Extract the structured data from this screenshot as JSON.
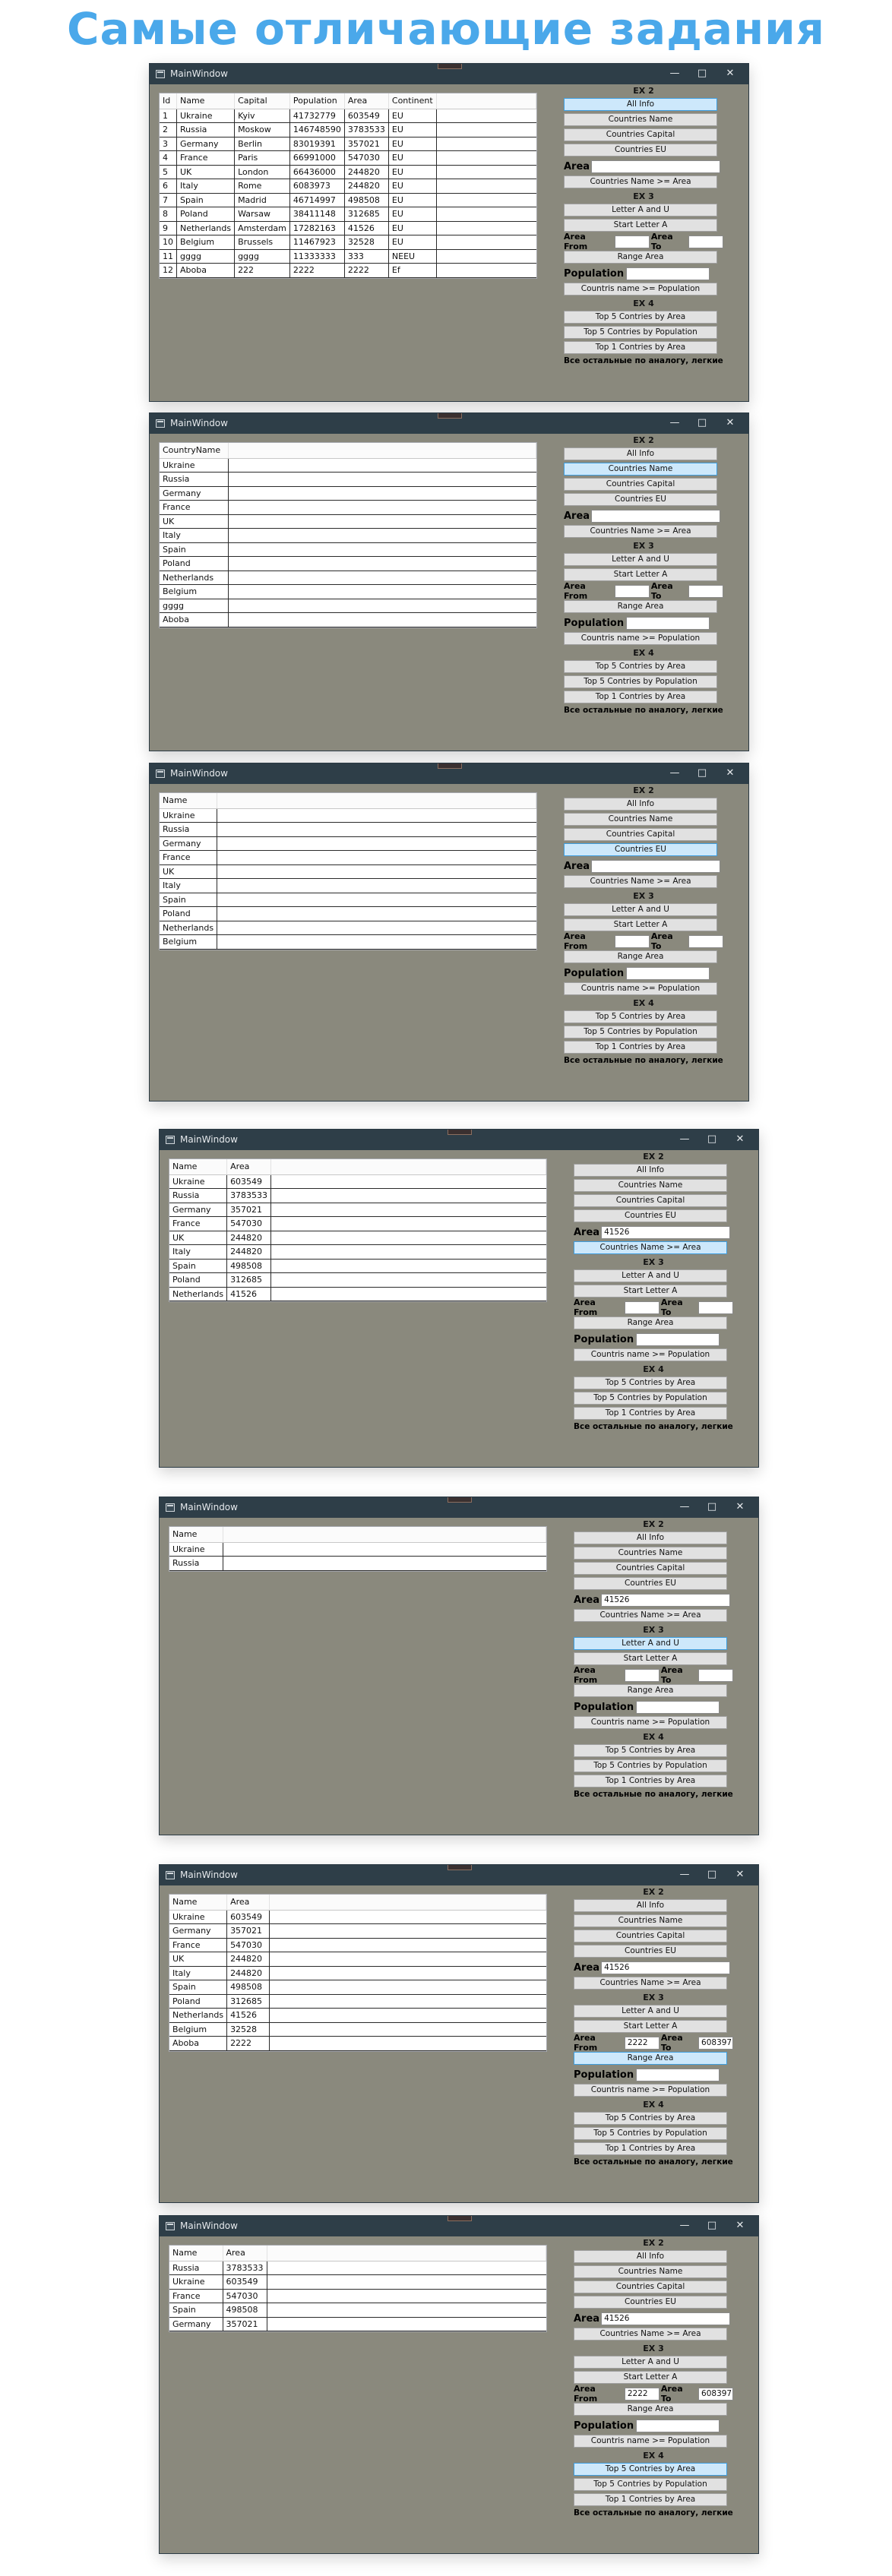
{
  "page_title": "Самые отличающие задания",
  "panel": {
    "ex2_title": "EX 2",
    "all_info": "All Info",
    "countries_name": "Countries Name",
    "countries_capital": "Countries Capital",
    "countries_eu": "Countries EU",
    "area_label": "Area",
    "countries_name_area": "Countries Name >= Area",
    "ex3_title": "EX 3",
    "letter_a_u": "Letter A and U",
    "start_letter_a": "Start Letter A",
    "area_from_label": "Area From",
    "area_to_label": "Area To",
    "range_area": "Range Area",
    "population_label": "Population",
    "countries_name_population": "Countris name >= Population",
    "ex4_title": "EX 4",
    "top5_area": "Top 5 Contries by Area",
    "top5_population": "Top 5 Contries by Population",
    "top1_area": "Top 1 Contries by Area",
    "note": "Все остальные по аналогу, легкие"
  },
  "windows": [
    {
      "title": "MainWindow",
      "columns": [
        "Id",
        "Name",
        "Capital",
        "Population",
        "Area",
        "Continent"
      ],
      "rows": [
        [
          "1",
          "Ukraine",
          "Kyiv",
          "41732779",
          "603549",
          "EU"
        ],
        [
          "2",
          "Russia",
          "Moskow",
          "146748590",
          "3783533",
          "EU"
        ],
        [
          "3",
          "Germany",
          "Berlin",
          "83019391",
          "357021",
          "EU"
        ],
        [
          "4",
          "France",
          "Paris",
          "66991000",
          "547030",
          "EU"
        ],
        [
          "5",
          "UK",
          "London",
          "66436000",
          "244820",
          "EU"
        ],
        [
          "6",
          "Italy",
          "Rome",
          "6083973",
          "244820",
          "EU"
        ],
        [
          "7",
          "Spain",
          "Madrid",
          "46714997",
          "498508",
          "EU"
        ],
        [
          "8",
          "Poland",
          "Warsaw",
          "38411148",
          "312685",
          "EU"
        ],
        [
          "9",
          "Netherlands",
          "Amsterdam",
          "17282163",
          "41526",
          "EU"
        ],
        [
          "10",
          "Belgium",
          "Brussels",
          "11467923",
          "32528",
          "EU"
        ],
        [
          "11",
          "gggg",
          "gggg",
          "11333333",
          "333",
          "NEEU"
        ],
        [
          "12",
          "Aboba",
          "222",
          "2222",
          "2222",
          "Ef"
        ]
      ],
      "area_value": "",
      "area_from": "",
      "area_to": "",
      "population_value": "",
      "active_button": "all_info"
    },
    {
      "title": "MainWindow",
      "columns": [
        "CountryName"
      ],
      "rows": [
        [
          "Ukraine"
        ],
        [
          "Russia"
        ],
        [
          "Germany"
        ],
        [
          "France"
        ],
        [
          "UK"
        ],
        [
          "Italy"
        ],
        [
          "Spain"
        ],
        [
          "Poland"
        ],
        [
          "Netherlands"
        ],
        [
          "Belgium"
        ],
        [
          "gggg"
        ],
        [
          "Aboba"
        ]
      ],
      "area_value": "",
      "area_from": "",
      "area_to": "",
      "population_value": "",
      "active_button": "countries_name"
    },
    {
      "title": "MainWindow",
      "columns": [
        "Name"
      ],
      "rows": [
        [
          "Ukraine"
        ],
        [
          "Russia"
        ],
        [
          "Germany"
        ],
        [
          "France"
        ],
        [
          "UK"
        ],
        [
          "Italy"
        ],
        [
          "Spain"
        ],
        [
          "Poland"
        ],
        [
          "Netherlands"
        ],
        [
          "Belgium"
        ]
      ],
      "area_value": "",
      "area_from": "",
      "area_to": "",
      "population_value": "",
      "active_button": "countries_eu"
    },
    {
      "title": "MainWindow",
      "columns": [
        "Name",
        "Area"
      ],
      "rows": [
        [
          "Ukraine",
          "603549"
        ],
        [
          "Russia",
          "3783533"
        ],
        [
          "Germany",
          "357021"
        ],
        [
          "France",
          "547030"
        ],
        [
          "UK",
          "244820"
        ],
        [
          "Italy",
          "244820"
        ],
        [
          "Spain",
          "498508"
        ],
        [
          "Poland",
          "312685"
        ],
        [
          "Netherlands",
          "41526"
        ]
      ],
      "area_value": "41526",
      "area_from": "",
      "area_to": "",
      "population_value": "",
      "active_button": "countries_name_area"
    },
    {
      "title": "MainWindow",
      "columns": [
        "Name"
      ],
      "rows": [
        [
          "Ukraine"
        ],
        [
          "Russia"
        ]
      ],
      "area_value": "41526",
      "area_from": "",
      "area_to": "",
      "population_value": "",
      "active_button": "letter_a_u"
    },
    {
      "title": "MainWindow",
      "columns": [
        "Name",
        "Area"
      ],
      "rows": [
        [
          "Ukraine",
          "603549"
        ],
        [
          "Germany",
          "357021"
        ],
        [
          "France",
          "547030"
        ],
        [
          "UK",
          "244820"
        ],
        [
          "Italy",
          "244820"
        ],
        [
          "Spain",
          "498508"
        ],
        [
          "Poland",
          "312685"
        ],
        [
          "Netherlands",
          "41526"
        ],
        [
          "Belgium",
          "32528"
        ],
        [
          "Aboba",
          "2222"
        ]
      ],
      "area_value": "41526",
      "area_from": "2222",
      "area_to": "608397",
      "population_value": "",
      "active_button": "range_area"
    },
    {
      "title": "MainWindow",
      "columns": [
        "Name",
        "Area"
      ],
      "rows": [
        [
          "Russia",
          "3783533"
        ],
        [
          "Ukraine",
          "603549"
        ],
        [
          "France",
          "547030"
        ],
        [
          "Spain",
          "498508"
        ],
        [
          "Germany",
          "357021"
        ]
      ],
      "area_value": "41526",
      "area_from": "2222",
      "area_to": "608397",
      "population_value": "",
      "active_button": "top5_area"
    }
  ]
}
